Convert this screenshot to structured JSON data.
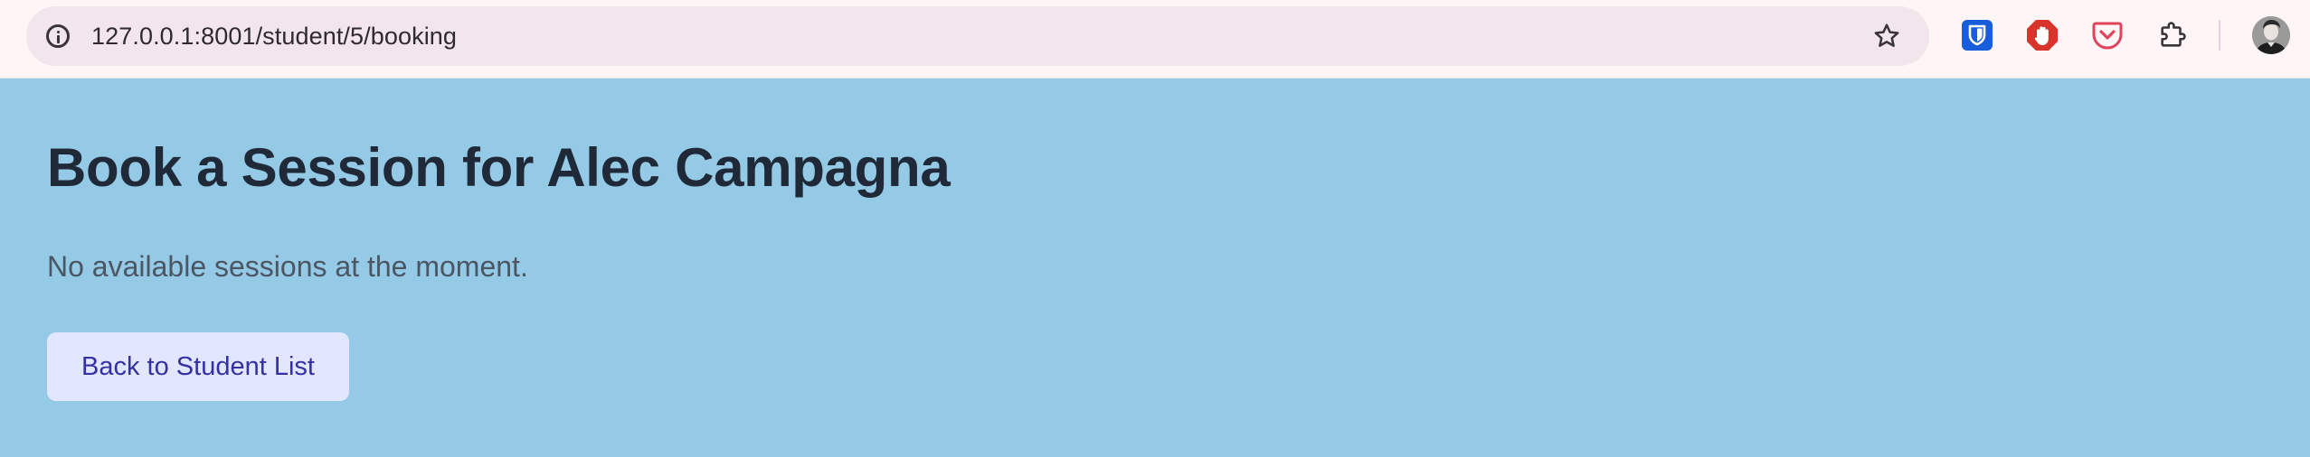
{
  "browser": {
    "url": "127.0.0.1:8001/student/5/booking",
    "icons": {
      "site_info": "info-icon",
      "bookmark": "star-icon",
      "extensions": [
        "bitwarden-icon",
        "adblock-icon",
        "pocket-icon",
        "extensions-puzzle-icon"
      ],
      "profile": "avatar"
    }
  },
  "page": {
    "title": "Book a Session for Alec Campagna",
    "message": "No available sessions at the moment.",
    "back_button_label": "Back to Student List"
  },
  "colors": {
    "page_background": "#94cae6",
    "title": "#1f2937",
    "message": "#4b5563",
    "button_background": "#e0e7ff",
    "button_text": "#3730a3"
  }
}
